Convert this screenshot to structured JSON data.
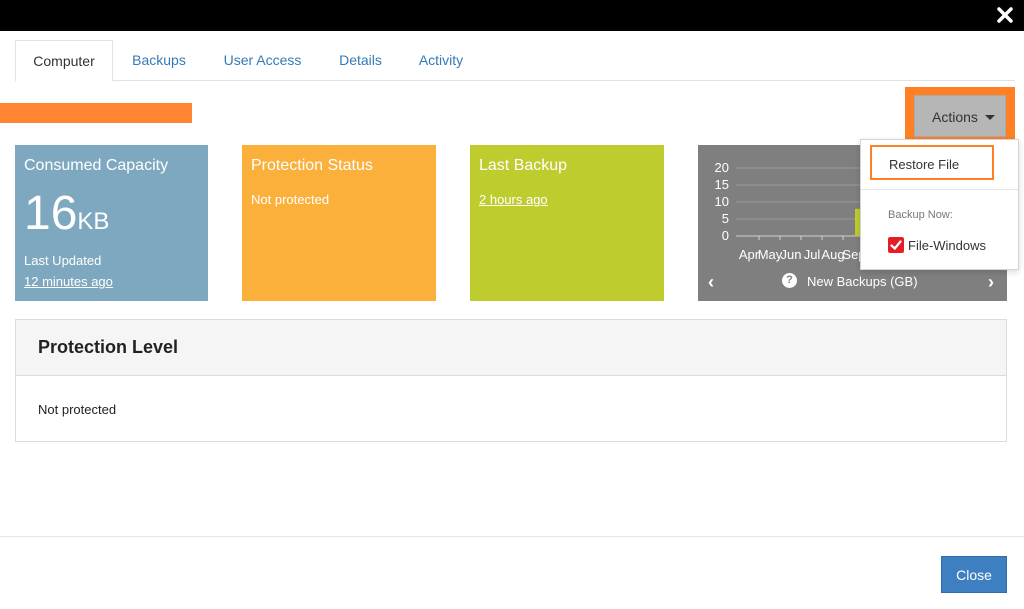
{
  "tabs": [
    {
      "label": "Computer",
      "active": true
    },
    {
      "label": "Backups",
      "active": false
    },
    {
      "label": "User Access",
      "active": false
    },
    {
      "label": "Details",
      "active": false
    },
    {
      "label": "Activity",
      "active": false
    }
  ],
  "actions": {
    "label": "Actions"
  },
  "tiles": {
    "capacity": {
      "title": "Consumed Capacity",
      "value": "16",
      "unit": "KB",
      "last_updated_label": "Last Updated",
      "last_updated_value": "12 minutes ago"
    },
    "protection": {
      "title": "Protection Status",
      "value": "Not protected"
    },
    "last_backup": {
      "title": "Last Backup",
      "value": "2 hours ago"
    },
    "chart": {
      "caption": "New Backups (GB)"
    }
  },
  "dropdown": {
    "restore_label": "Restore File",
    "backup_now_header": "Backup Now:",
    "items": [
      {
        "label": "File-Windows",
        "checked": true
      }
    ]
  },
  "protection_level": {
    "title": "Protection Level",
    "body": "Not protected"
  },
  "footer": {
    "close_label": "Close"
  },
  "colors": {
    "accent_orange": "#ff7f24",
    "primary_blue": "#3d7fc1",
    "capacity_tile": "#7ea8bf",
    "status_tile": "#fbb03b",
    "backup_tile": "#bfcc2d",
    "chart_tile": "#7f7f7f",
    "check_red": "#e31e24"
  },
  "chart_data": {
    "type": "bar",
    "categories": [
      "Apr",
      "May",
      "Jun",
      "Jul",
      "Aug",
      "Sep"
    ],
    "values": [
      0,
      0,
      0,
      0,
      0,
      8
    ],
    "ylim": [
      0,
      20
    ],
    "yticks": [
      0,
      5,
      10,
      15,
      20
    ],
    "title": "New Backups (GB)",
    "xlabel": "",
    "ylabel": "",
    "grid": true
  }
}
